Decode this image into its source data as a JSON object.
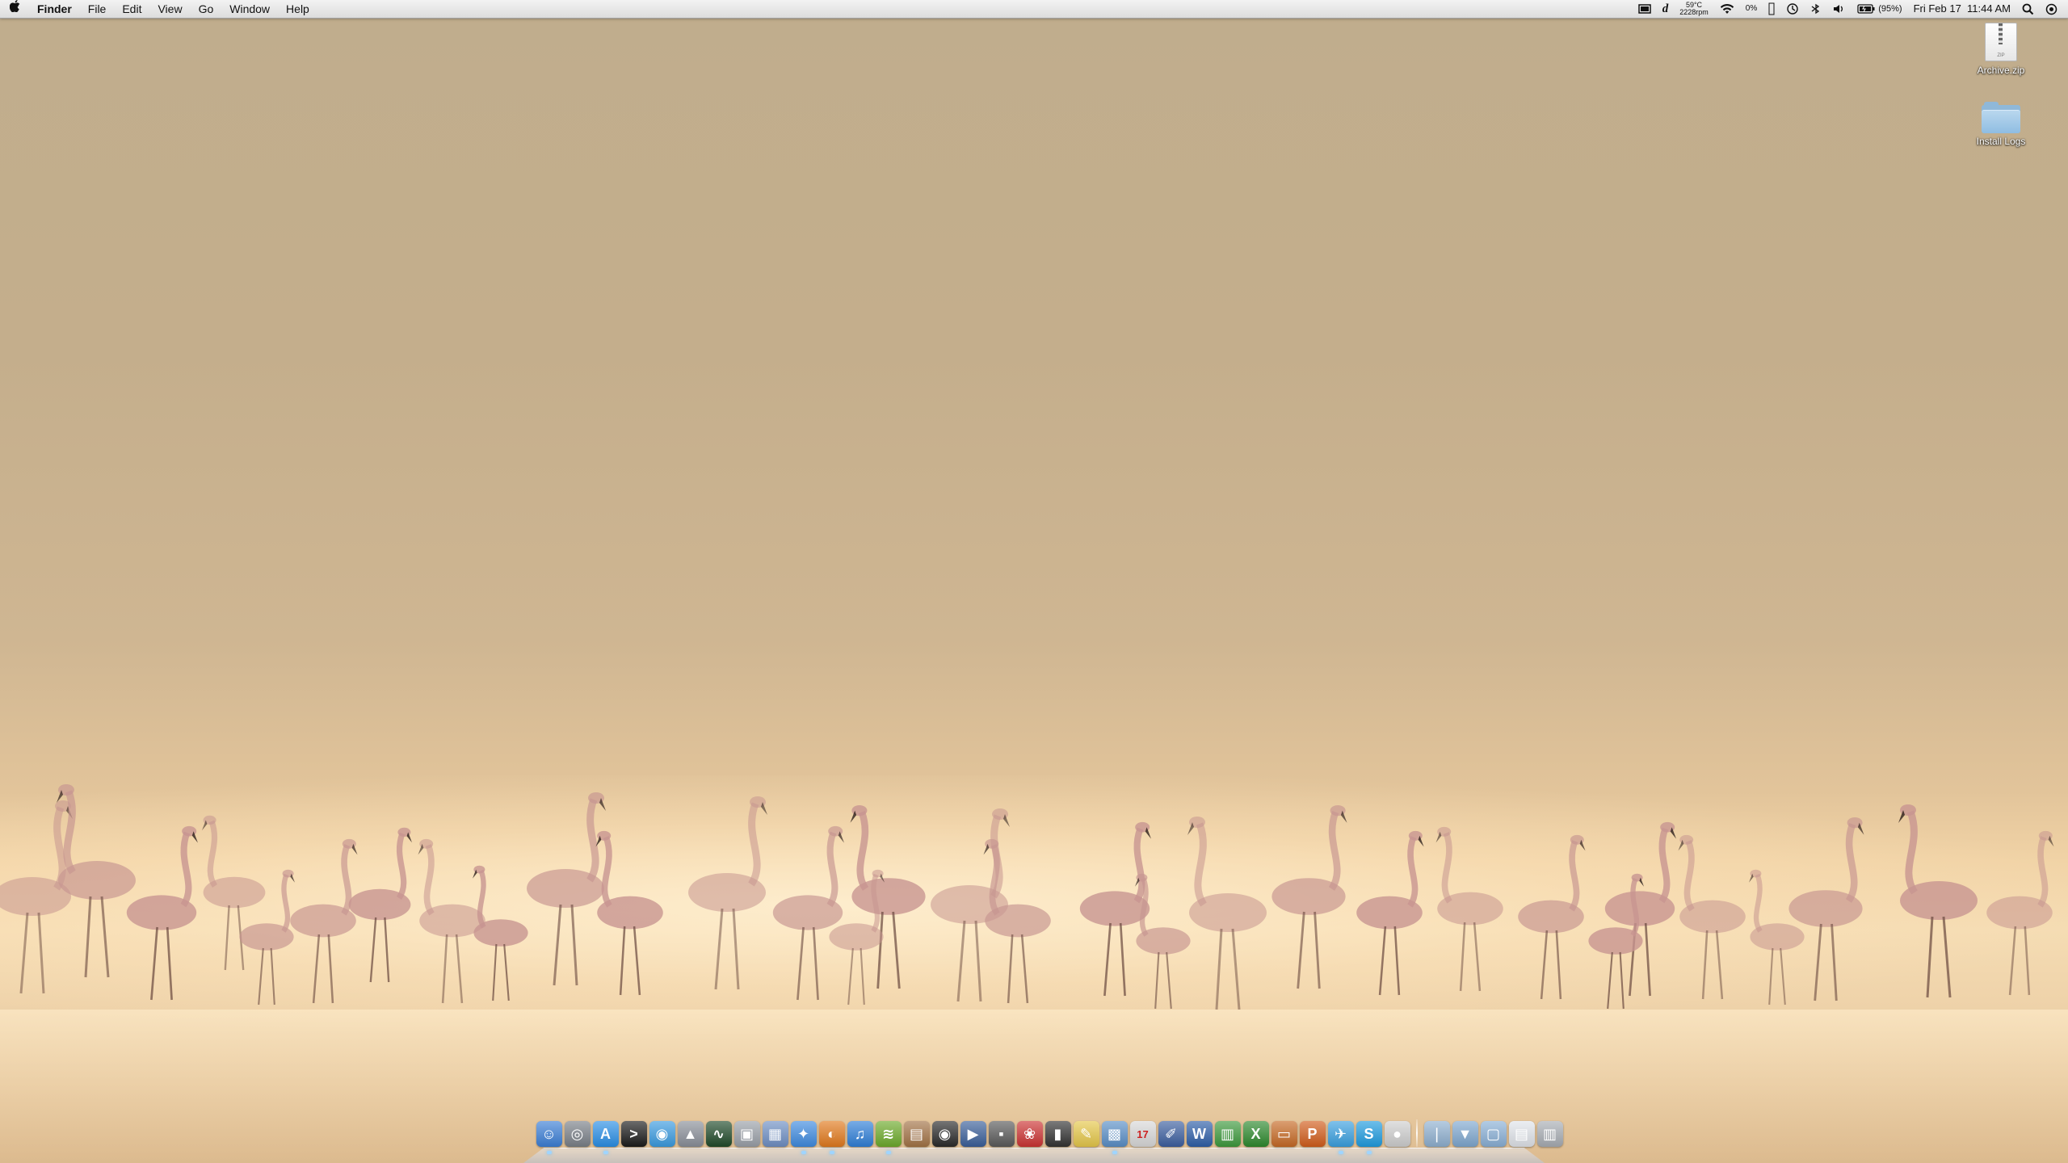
{
  "menubar": {
    "app_name": "Finder",
    "menus": [
      "File",
      "Edit",
      "View",
      "Go",
      "Window",
      "Help"
    ],
    "status": {
      "temp": "59°C",
      "fan": "2228rpm",
      "cpu": "0%",
      "battery": "(95%)",
      "datetime": "Fri Feb 17  11:44 AM"
    },
    "status_icons": [
      "display-icon",
      "dictionary-icon",
      "temperature-readout",
      "wifi-icon",
      "cpu-meter",
      "battery-small-icon",
      "time-machine-icon",
      "bluetooth-icon",
      "volume-icon",
      "battery-icon",
      "spotlight-icon",
      "notification-icon"
    ]
  },
  "desktop": {
    "icons": [
      {
        "label": "Archive.zip",
        "kind": "zip-file-icon",
        "badge": "ZIP"
      },
      {
        "label": "Install Logs",
        "kind": "folder-icon"
      }
    ],
    "wallpaper": "flamingos-in-misty-lake"
  },
  "dock": {
    "apps": [
      {
        "name": "finder-icon",
        "color": "#3c7fd6",
        "glyph": "☺",
        "running": true
      },
      {
        "name": "screenshot-icon",
        "color": "#7a8088",
        "glyph": "◎",
        "running": false
      },
      {
        "name": "app-store-icon",
        "color": "#2a8fe6",
        "glyph": "A",
        "running": true
      },
      {
        "name": "terminal-icon",
        "color": "#1b1b1b",
        "glyph": ">",
        "running": false
      },
      {
        "name": "wifi-diagnostics-icon",
        "color": "#3a9be0",
        "glyph": "◉",
        "running": false
      },
      {
        "name": "cleaner-icon",
        "color": "#8a8f99",
        "glyph": "▲",
        "running": false
      },
      {
        "name": "activity-monitor-icon",
        "color": "#204a2a",
        "glyph": "∿",
        "running": false
      },
      {
        "name": "disk-utility-icon",
        "color": "#9aa0a8",
        "glyph": "▣",
        "running": false
      },
      {
        "name": "preview-icon",
        "color": "#6e8fc4",
        "glyph": "▦",
        "running": false
      },
      {
        "name": "safari-icon",
        "color": "#3e8be0",
        "glyph": "✦",
        "running": true
      },
      {
        "name": "firefox-icon",
        "color": "#e27a1d",
        "glyph": "◐",
        "running": true
      },
      {
        "name": "itunes-icon",
        "color": "#2f7fd8",
        "glyph": "♫",
        "running": false
      },
      {
        "name": "spotify-icon",
        "color": "#6dab2b",
        "glyph": "≋",
        "running": true
      },
      {
        "name": "photos-icon",
        "color": "#a37346",
        "glyph": "▤",
        "running": false
      },
      {
        "name": "dvd-player-icon",
        "color": "#2a2a2a",
        "glyph": "◉",
        "running": false
      },
      {
        "name": "quicktime-icon",
        "color": "#3a5f9a",
        "glyph": "▶",
        "running": false
      },
      {
        "name": "tv-icon",
        "color": "#5a5a5a",
        "glyph": "▪",
        "running": false
      },
      {
        "name": "flickr-icon",
        "color": "#c33",
        "glyph": "❀",
        "running": false
      },
      {
        "name": "notes-icon",
        "color": "#333",
        "glyph": "▮",
        "running": false
      },
      {
        "name": "stickies-icon",
        "color": "#e6c84a",
        "glyph": "✎",
        "running": false
      },
      {
        "name": "remote-desktop-icon",
        "color": "#5a8fc7",
        "glyph": "▩",
        "running": true
      },
      {
        "name": "calendar-icon",
        "color": "#d9d9d9",
        "glyph": "17",
        "running": false
      },
      {
        "name": "pencil-icon",
        "color": "#3c5fa0",
        "glyph": "✐",
        "running": false
      },
      {
        "name": "word-icon",
        "color": "#2d5ea8",
        "glyph": "W",
        "running": false
      },
      {
        "name": "numbers-icon",
        "color": "#3d9a3d",
        "glyph": "▥",
        "running": false
      },
      {
        "name": "excel-icon",
        "color": "#2e8a2e",
        "glyph": "X",
        "running": false
      },
      {
        "name": "keynote-icon",
        "color": "#c76a25",
        "glyph": "▭",
        "running": false
      },
      {
        "name": "powerpoint-icon",
        "color": "#d25d1b",
        "glyph": "P",
        "running": false
      },
      {
        "name": "twitter-icon",
        "color": "#3aa0e0",
        "glyph": "✈",
        "running": true
      },
      {
        "name": "skype-icon",
        "color": "#1f9ce0",
        "glyph": "S",
        "running": true
      },
      {
        "name": "mouse-icon",
        "color": "#cfcfcf",
        "glyph": "●",
        "running": false
      },
      {
        "name": "applications-stack-icon",
        "color": "#8fb0d0",
        "glyph": "❘",
        "running": false
      },
      {
        "name": "downloads-stack-icon",
        "color": "#7fa8d0",
        "glyph": "▼",
        "running": false
      },
      {
        "name": "documents-stack-icon",
        "color": "#8ab0d6",
        "glyph": "▢",
        "running": false
      },
      {
        "name": "screenshot-stack-icon",
        "color": "#e0e4ea",
        "glyph": "▤",
        "running": false
      },
      {
        "name": "trash-icon",
        "color": "#a8adb4",
        "glyph": "▥",
        "running": false
      }
    ]
  },
  "colors": {
    "sky_top": "#c0ad8d",
    "horizon": "#f5dcb3",
    "flamingo": "#c79590"
  }
}
